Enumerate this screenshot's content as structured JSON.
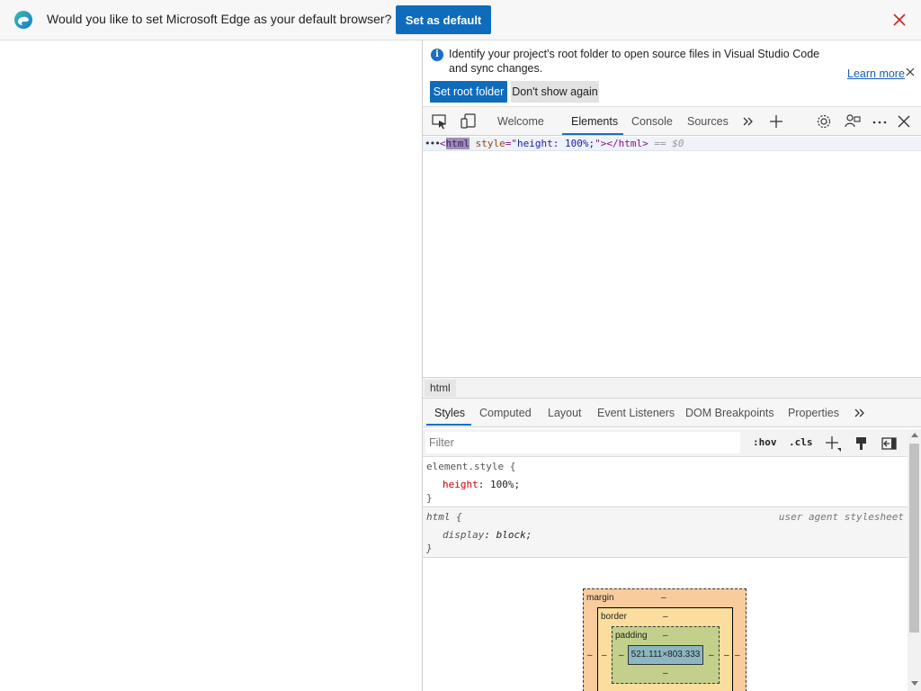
{
  "infobar": {
    "message": "Would you like to set Microsoft Edge as your default browser?",
    "primary_button": "Set as default"
  },
  "devtools": {
    "notice": {
      "text": "Identify your project's root folder to open source files in Visual Studio Code and sync changes.",
      "learn_more": "Learn more",
      "primary_button": "Set root folder",
      "secondary_button": "Don't show again"
    },
    "tabs": [
      {
        "label": "Welcome",
        "active": false
      },
      {
        "label": "Elements",
        "active": true
      },
      {
        "label": "Console",
        "active": false
      },
      {
        "label": "Sources",
        "active": false
      }
    ],
    "dom": {
      "dots": "•••",
      "open": "<",
      "tag": "html",
      "attr_name": "style",
      "attr_eq": "=\"",
      "attr_value": "height: 100%;",
      "attr_close": "\">",
      "close_tag": "</html>",
      "selected_marker": "== $0"
    },
    "breadcrumb": "html",
    "subtabs": [
      {
        "label": "Styles",
        "active": true
      },
      {
        "label": "Computed",
        "active": false
      },
      {
        "label": "Layout",
        "active": false
      },
      {
        "label": "Event Listeners",
        "active": false
      },
      {
        "label": "DOM Breakpoints",
        "active": false
      },
      {
        "label": "Properties",
        "active": false
      }
    ],
    "filter": {
      "placeholder": "Filter",
      "hov": ":hov",
      "cls": ".cls"
    },
    "styles": {
      "rule1": {
        "selector": "element.style {",
        "prop": "height",
        "value": "100%;",
        "close": "}"
      },
      "rule2": {
        "selector": "html {",
        "source": "user agent stylesheet",
        "prop": "display",
        "value": "block;",
        "close": "}"
      }
    },
    "box_model": {
      "margin_label": "margin",
      "border_label": "border",
      "padding_label": "padding",
      "dash": "–",
      "content": "521.111×803.333"
    }
  },
  "colors": {
    "accent": "#0f6cbd",
    "margin": "#f9cc9d",
    "border": "#fbdd9d",
    "padding": "#c3d08b",
    "content": "#8cb6c0"
  }
}
